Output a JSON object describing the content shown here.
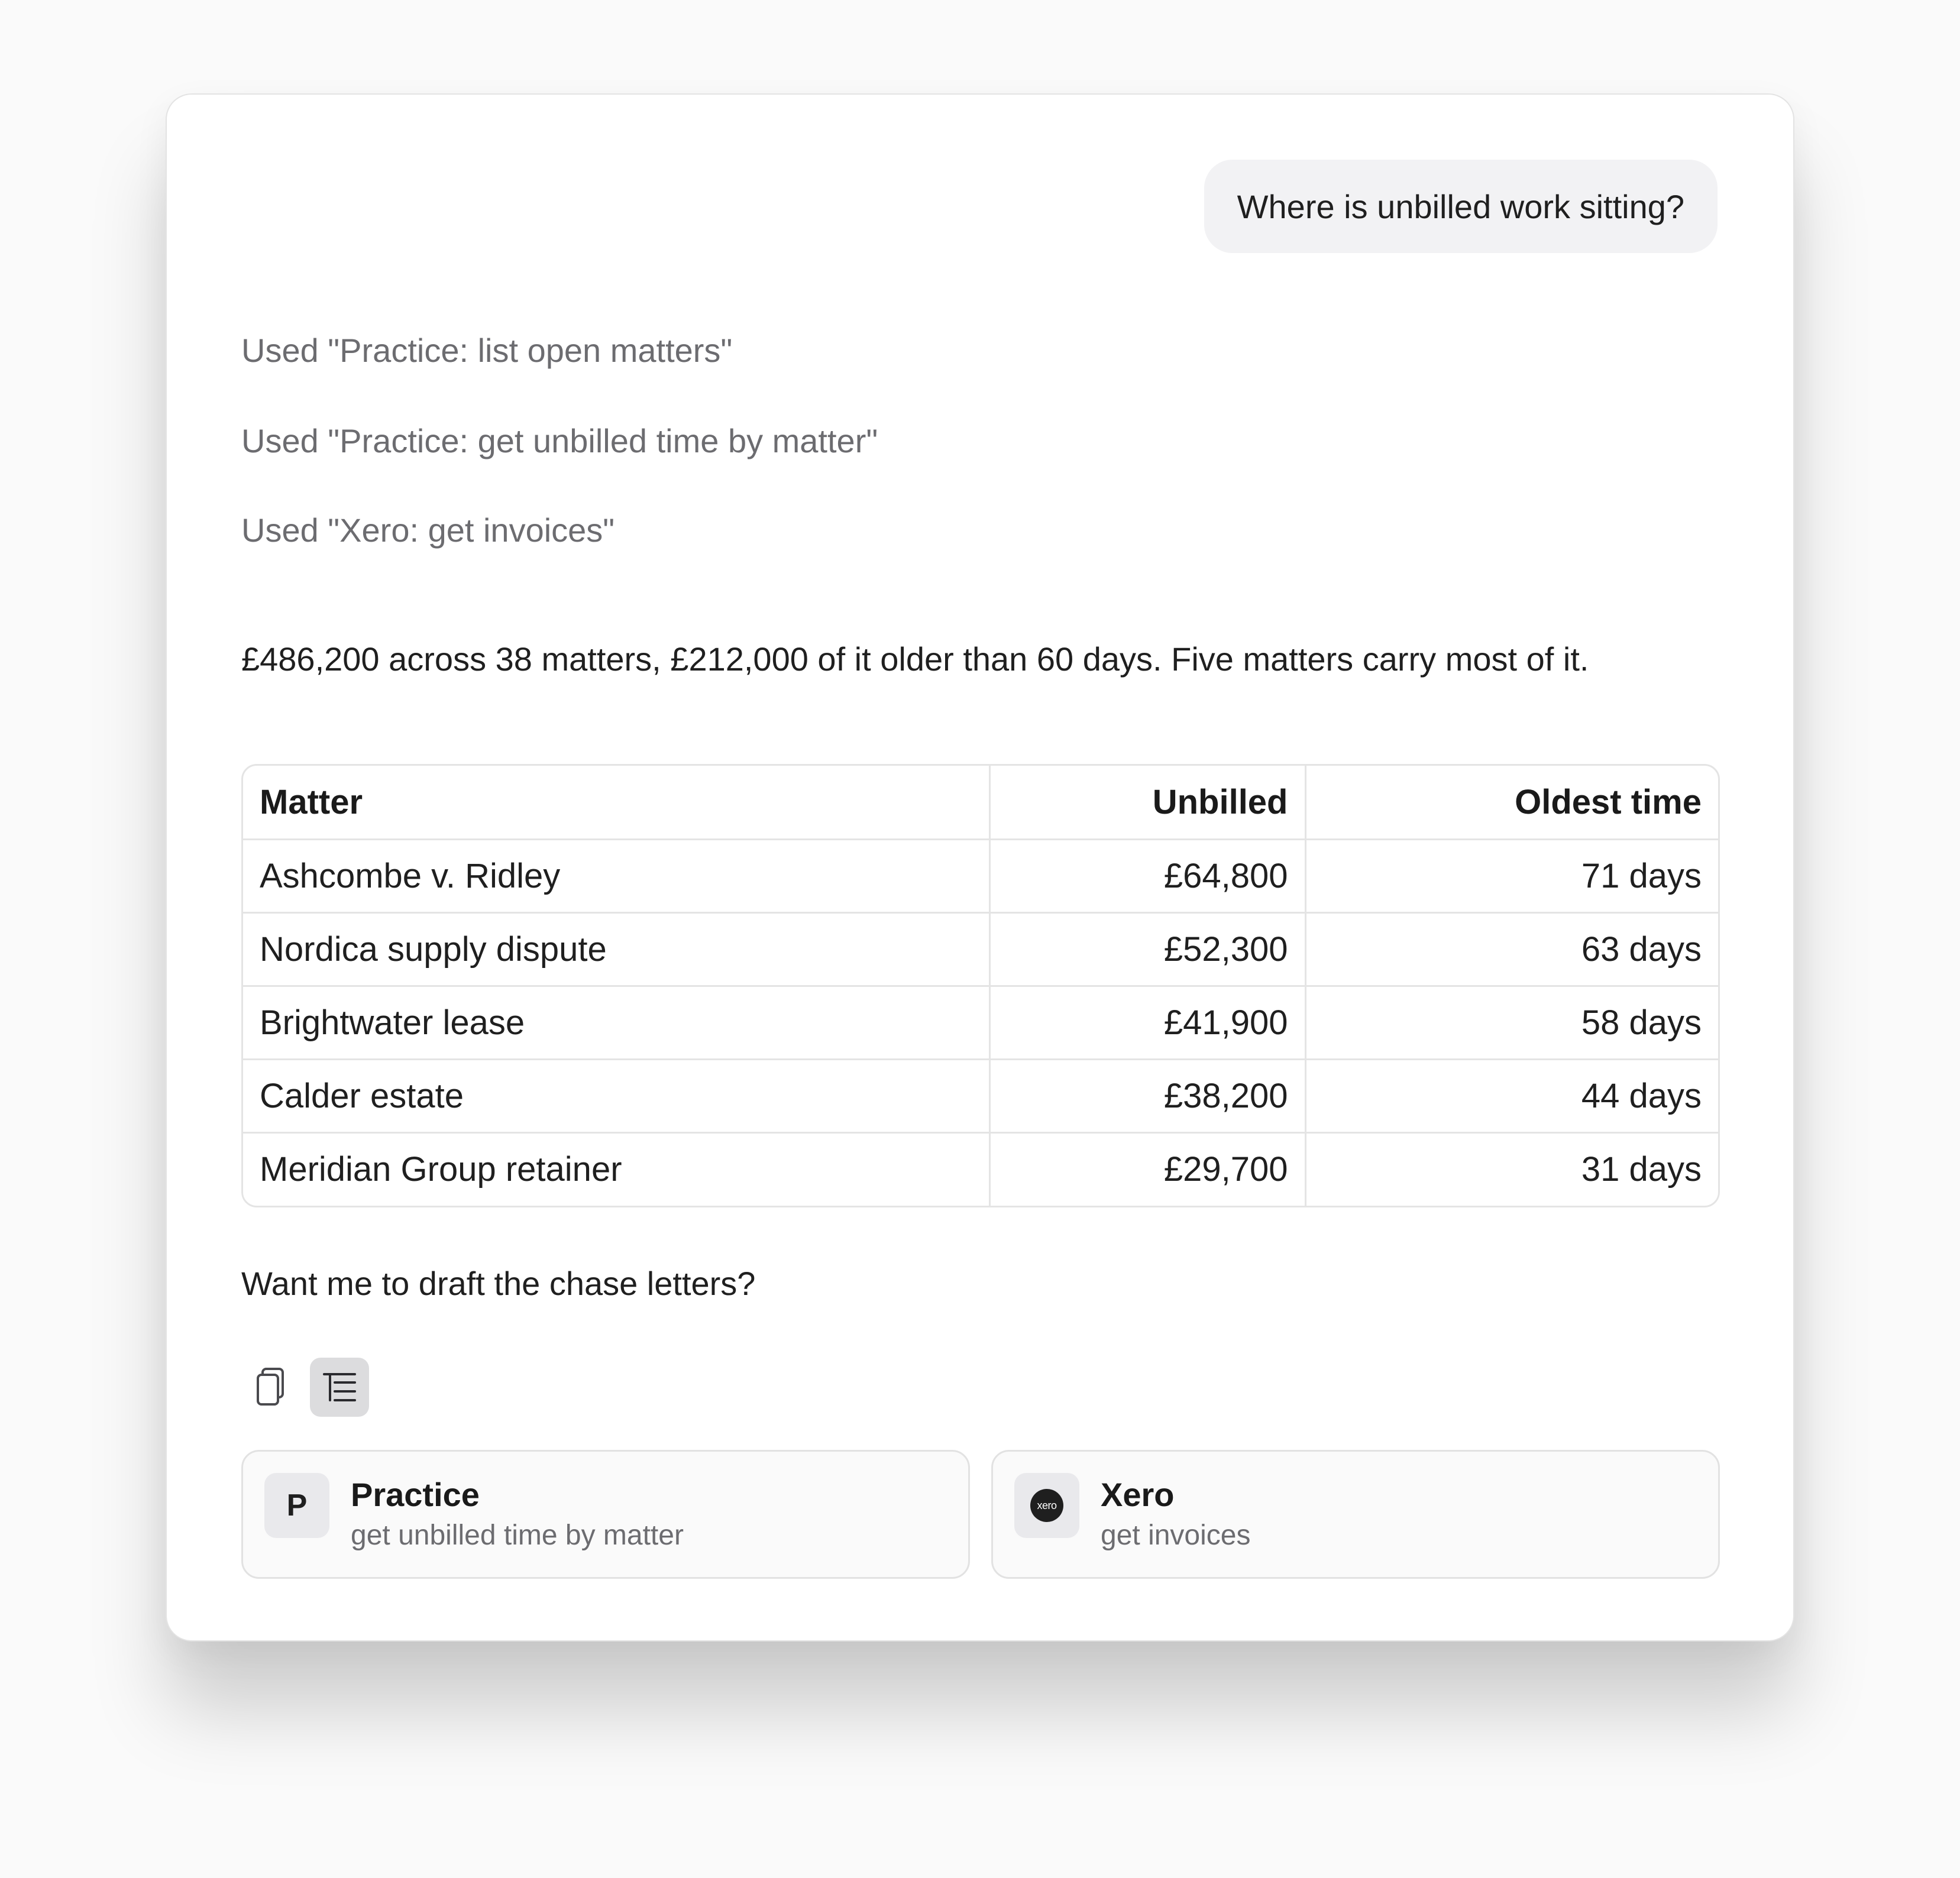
{
  "conversation": {
    "user_message": "Where is unbilled work sitting?",
    "tool_calls": [
      "Used \"Practice: list open matters\"",
      "Used \"Practice: get unbilled time by matter\"",
      "Used \"Xero: get invoices\""
    ],
    "summary": "£486,200 across 38 matters, £212,000 of it older than 60 days. Five matters carry most of it.",
    "followup": "Want me to draft the chase letters?"
  },
  "table": {
    "headers": [
      "Matter",
      "Unbilled",
      "Oldest time"
    ],
    "rows": [
      [
        "Ashcombe v. Ridley",
        "£64,800",
        "71 days"
      ],
      [
        "Nordica supply dispute",
        "£52,300",
        "63 days"
      ],
      [
        "Brightwater lease",
        "£41,900",
        "58 days"
      ],
      [
        "Calder estate",
        "£38,200",
        "44 days"
      ],
      [
        "Meridian Group retainer",
        "£29,700",
        "31 days"
      ]
    ]
  },
  "actions": {
    "copy_icon": "copy-icon",
    "tree_icon": "tree-list-icon"
  },
  "sources": [
    {
      "logo_letter": "P",
      "title": "Practice",
      "subtitle": "get unbilled time by matter"
    },
    {
      "logo_text": "xero",
      "title": "Xero",
      "subtitle": "get invoices"
    }
  ],
  "colors": {
    "user_bubble_bg": "#f2f2f4",
    "muted_text": "#6c6c70",
    "active_button_bg": "#dcdcde"
  }
}
